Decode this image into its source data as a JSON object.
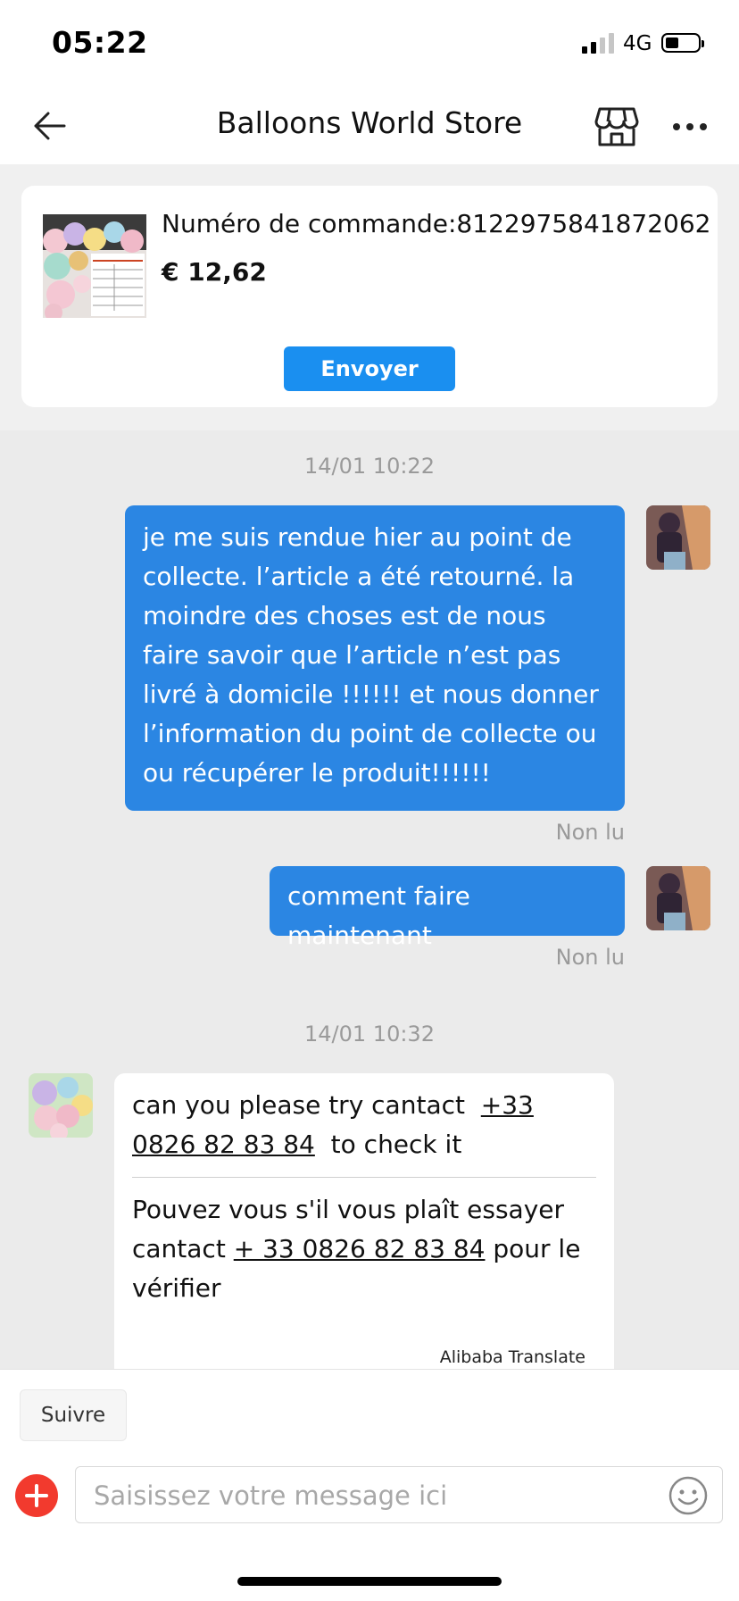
{
  "status_bar": {
    "time": "05:22",
    "network": "4G"
  },
  "header": {
    "title": "Balloons World Store"
  },
  "order": {
    "label": "Numéro de commande:8122975841872062",
    "price": "€ 12,62",
    "send_label": "Envoyer"
  },
  "chat": {
    "timestamp1": "14/01 10:22",
    "msg1": "je me suis rendue hier au point de collecte. l’article a été retourné. la moindre des choses est de nous faire savoir que l’article n’est pas livré  à domicile !!!!!! et nous donner l’information du point de collecte ou ou récupérer le produit!!!!!!",
    "msg1_status": "Non lu",
    "msg2": "comment faire  maintenant",
    "msg2_status": "Non lu",
    "timestamp2": "14/01 10:32",
    "reply": {
      "en_before": "can you please try cantact  ",
      "en_phone": "+33 0826 82 83 84",
      "en_after": "  to check it",
      "fr_before": "Pouvez vous s'il vous plaît essayer cantact ",
      "fr_phone": "+ 33 0826 82 83 84",
      "fr_after": " pour le vérifier",
      "translator": "Alibaba Translate"
    }
  },
  "footer": {
    "follow_label": "Suivre",
    "input_placeholder": "Saisissez votre message ici"
  },
  "colors": {
    "accent": "#1a8ff0",
    "my_bubble": "#2b86e3",
    "add_button": "#f23a2e"
  }
}
